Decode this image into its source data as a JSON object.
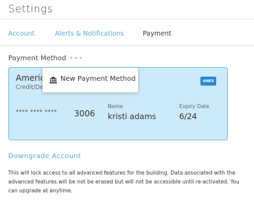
{
  "page": {
    "title": "Settings"
  },
  "tabs": [
    {
      "label": "Account",
      "active": false
    },
    {
      "label": "Alerts & Notifications",
      "active": false
    },
    {
      "label": "Payment",
      "active": true
    }
  ],
  "payment_method": {
    "label": "Payment Method",
    "menu_trigger": "•••",
    "menu": {
      "items": [
        {
          "label": "New Payment Method",
          "icon": "bank-icon"
        }
      ]
    }
  },
  "card": {
    "brand_text": "Americ",
    "type_text": "Credit/De",
    "logo_text": "AMEX",
    "mask": "**** **** ****",
    "last4": "3006",
    "name_label": "Name",
    "name_value": "kristi adams",
    "expiry_label": "Expiry Date",
    "expiry_value": "6/24"
  },
  "downgrade": {
    "label": "Downgrade Account",
    "note": "This will lock access to all advanced features for the building. Data associated with the advanced features will be not be erased but will not be accessible until re-activated. You can upgrade at anytime."
  },
  "colors": {
    "accent": "#5ba9d4",
    "card_bg": "#cdeaf8",
    "card_border": "#6cc0ee",
    "amex": "#2a8ad0"
  }
}
